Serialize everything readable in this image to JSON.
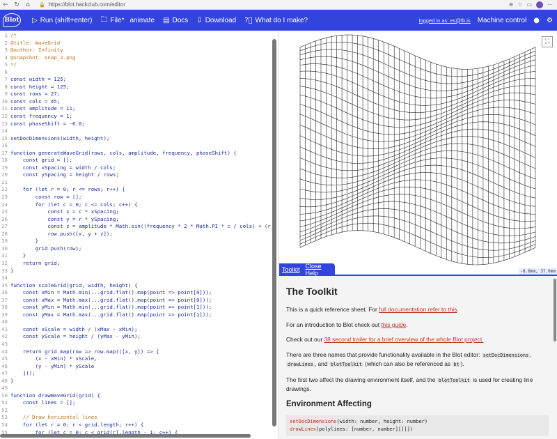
{
  "browser": {
    "url": "https://blot.hackclub.com/editor"
  },
  "header": {
    "logo": "Blot",
    "run_label": "Run (shift+enter)",
    "file_label": "File*",
    "animate_label": "animate",
    "docs_label": "Docs",
    "download_label": "Download",
    "help_label": "What do I make?",
    "login_text": "logged in as: es@fb.is",
    "machine_label": "Machine control"
  },
  "editor": {
    "lines": [
      {
        "n": "1",
        "t": "/*",
        "c": "comment"
      },
      {
        "n": "2",
        "t": "@title: WaveGrid",
        "c": "comment"
      },
      {
        "n": "3",
        "t": "@author: Infinity",
        "c": "comment"
      },
      {
        "n": "4",
        "t": "@snapshot: snap_2.png",
        "c": "comment"
      },
      {
        "n": "5",
        "t": "*/",
        "c": "comment"
      },
      {
        "n": "6",
        "t": "",
        "c": ""
      },
      {
        "n": "7",
        "t": "const width = 125;",
        "c": "kw"
      },
      {
        "n": "8",
        "t": "const height = 125;",
        "c": "kw"
      },
      {
        "n": "9",
        "t": "const rows = 27;",
        "c": "kw"
      },
      {
        "n": "10",
        "t": "const cols = 45;",
        "c": "kw"
      },
      {
        "n": "11",
        "t": "const amplitude = 11;",
        "c": "kw"
      },
      {
        "n": "12",
        "t": "const frequency = 1;",
        "c": "kw"
      },
      {
        "n": "13",
        "t": "const phaseShift = -6.0;",
        "c": "kw"
      },
      {
        "n": "14",
        "t": "",
        "c": ""
      },
      {
        "n": "15",
        "t": "setDocDimensions(width, height);",
        "c": "kw"
      },
      {
        "n": "16",
        "t": "",
        "c": ""
      },
      {
        "n": "17",
        "t": "function generateWaveGrid(rows, cols, amplitude, frequency, phaseShift) {",
        "c": "kw"
      },
      {
        "n": "18",
        "t": "    const grid = [];",
        "c": "kw"
      },
      {
        "n": "19",
        "t": "    const xSpacing = width / cols;",
        "c": "kw"
      },
      {
        "n": "20",
        "t": "    const ySpacing = height / rows;",
        "c": "kw"
      },
      {
        "n": "21",
        "t": "",
        "c": ""
      },
      {
        "n": "22",
        "t": "    for (let r = 0; r <= rows; r++) {",
        "c": "kw"
      },
      {
        "n": "23",
        "t": "        const row = [];",
        "c": "kw"
      },
      {
        "n": "24",
        "t": "        for (let c = 0; c <= cols; c++) {",
        "c": "kw"
      },
      {
        "n": "25",
        "t": "            const x = c * xSpacing;",
        "c": "kw"
      },
      {
        "n": "26",
        "t": "            const y = r * ySpacing;",
        "c": "kw"
      },
      {
        "n": "27",
        "t": "            const z = amplitude * Math.sin((frequency * 2 * Math.PI * c / cols) + (r * phas",
        "c": "kw"
      },
      {
        "n": "28",
        "t": "            row.push([x, y + z]);",
        "c": "kw"
      },
      {
        "n": "29",
        "t": "        }",
        "c": "kw"
      },
      {
        "n": "30",
        "t": "        grid.push(row);",
        "c": "kw"
      },
      {
        "n": "31",
        "t": "    }",
        "c": "kw"
      },
      {
        "n": "32",
        "t": "    return grid;",
        "c": "kw"
      },
      {
        "n": "33",
        "t": "}",
        "c": "kw"
      },
      {
        "n": "34",
        "t": "",
        "c": ""
      },
      {
        "n": "35",
        "t": "function scaleGrid(grid, width, height) {",
        "c": "kw"
      },
      {
        "n": "36",
        "t": "    const xMin = Math.min(...grid.flat().map(point => point[0]));",
        "c": "kw"
      },
      {
        "n": "37",
        "t": "    const xMax = Math.max(...grid.flat().map(point => point[0]));",
        "c": "kw"
      },
      {
        "n": "38",
        "t": "    const yMin = Math.min(...grid.flat().map(point => point[1]));",
        "c": "kw"
      },
      {
        "n": "39",
        "t": "    const yMax = Math.max(...grid.flat().map(point => point[1]));",
        "c": "kw"
      },
      {
        "n": "40",
        "t": "",
        "c": ""
      },
      {
        "n": "41",
        "t": "    const xScale = width / (xMax - xMin);",
        "c": "kw"
      },
      {
        "n": "42",
        "t": "    const yScale = height / (yMax - yMin);",
        "c": "kw"
      },
      {
        "n": "43",
        "t": "",
        "c": ""
      },
      {
        "n": "44",
        "t": "    return grid.map(row => row.map(([x, y]) => [",
        "c": "kw"
      },
      {
        "n": "45",
        "t": "        (x - xMin) * xScale,",
        "c": "kw"
      },
      {
        "n": "46",
        "t": "        (y - yMin) * yScale",
        "c": "kw"
      },
      {
        "n": "47",
        "t": "    ]));",
        "c": "kw"
      },
      {
        "n": "48",
        "t": "}",
        "c": "kw"
      },
      {
        "n": "49",
        "t": "",
        "c": ""
      },
      {
        "n": "50",
        "t": "function drawWaveGrid(grid) {",
        "c": "kw"
      },
      {
        "n": "51",
        "t": "    const lines = [];",
        "c": "kw"
      },
      {
        "n": "52",
        "t": "",
        "c": ""
      },
      {
        "n": "53",
        "t": "    // Draw horizontal lines",
        "c": "comment"
      },
      {
        "n": "54",
        "t": "    for (let r = 0; r < grid.length; r++) {",
        "c": "kw"
      },
      {
        "n": "55",
        "t": "        for (let c = 0; c < grid[r].length - 1; c++) {",
        "c": "kw"
      }
    ]
  },
  "preview": {
    "coord_readout": "-8.8mm, 37.0mm",
    "fit_icon": "fit-screen-icon"
  },
  "toolkit": {
    "tab_toolkit": "Toolkit",
    "tab_close": "Close Help",
    "title": "The Toolkit",
    "p1_pre": "This is a quick reference sheet. For ",
    "p1_link": "full documentation refer to this",
    "p1_post": ".",
    "p2_pre": "For an introduction to Blot check out ",
    "p2_link": "this guide",
    "p2_post": ".",
    "p3_pre": "Check out our ",
    "p3_link": "38 second trailer for a brief overview of the whole Blot project.",
    "p4_a": "There are three names that provide functionality available in the Blot editor: ",
    "p4_code1": "setDocDimensions",
    "p4_b": ", ",
    "p4_code2": "drawLines",
    "p4_c": ", and ",
    "p4_code3": "blotToolkit",
    "p4_d": " (which can also be referenced as ",
    "p4_code4": "bt",
    "p4_e": ").",
    "p5_a": "The first two affect the drawing environment itself, and the ",
    "p5_code": "blotToolkit",
    "p5_b": " is used for creating line drawings.",
    "h2": "Environment Affecting",
    "code1_fn": "setDocDimensions",
    "code1_args": "(width: number, height: number)",
    "code2_fn": "drawLines",
    "code2_args": "(polylines: [number, number][][])"
  }
}
